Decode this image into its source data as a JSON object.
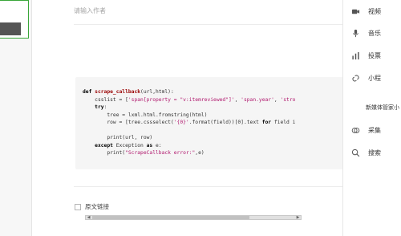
{
  "editor": {
    "author_placeholder": "请输入作者",
    "code_lines": [
      "def scrape_callback(url,html):",
      "    csslist = ['span[property = \"v:itemreviewed\"]', 'span.year', 'stro",
      "    try:",
      "        tree = lxml.html.fromstring(html)",
      "        row = [tree.cssselect('{0}'.format(field))[0].text for field i",
      "",
      "        print(url, row)",
      "    except Exception as e:",
      "        print(\"ScrapeCallback error:\",e)"
    ],
    "original_link_label": "原文链接"
  },
  "sidebar": {
    "items": [
      {
        "label": "视频",
        "icon": "video-icon"
      },
      {
        "label": "音乐",
        "icon": "microphone-icon"
      },
      {
        "label": "投票",
        "icon": "poll-icon"
      },
      {
        "label": "小程",
        "icon": "link-icon"
      }
    ],
    "section_title": "新媒体管家小",
    "tools": [
      {
        "label": "采集",
        "icon": "collect-icon"
      },
      {
        "label": "搜索",
        "icon": "search-icon"
      }
    ]
  }
}
